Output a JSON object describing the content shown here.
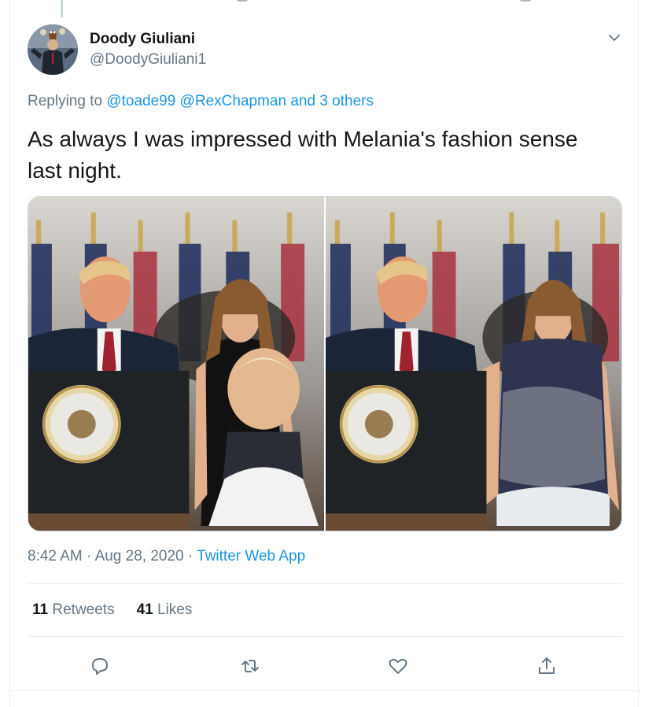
{
  "author": {
    "display_name": "Doody Giuliani",
    "handle": "@DoodyGiuliani1"
  },
  "reply": {
    "prefix": "Replying to",
    "mention_1": "@toade99",
    "mention_2": "@RexChapman",
    "others": "and 3 others"
  },
  "tweet": {
    "text": "As always I was impressed with Melania's fashion sense last night."
  },
  "media": {
    "count": 2
  },
  "meta": {
    "time": "8:42 AM",
    "separator": "·",
    "date": "Aug 28, 2020",
    "source": "Twitter Web App"
  },
  "stats": {
    "retweets_count": "11",
    "retweets_label": "Retweets",
    "likes_count": "41",
    "likes_label": "Likes"
  },
  "colors": {
    "link": "#1b95e0",
    "secondary_text": "#657786",
    "primary_text": "#14171a",
    "border": "#e6ecf0"
  },
  "icons": [
    "chevron-down-icon",
    "reply-icon",
    "retweet-icon",
    "like-icon",
    "share-icon"
  ]
}
